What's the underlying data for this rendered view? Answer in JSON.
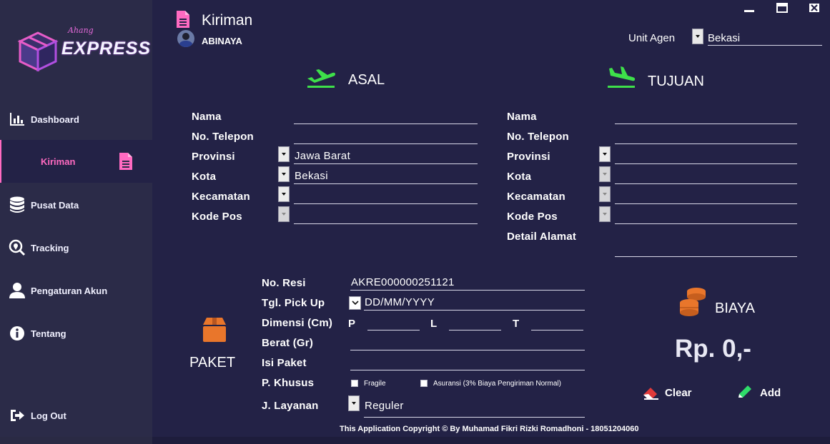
{
  "app": {
    "logo_small": "Ahang",
    "logo_main": "EXPRESS"
  },
  "sidebar": {
    "items": [
      {
        "label": "Dashboard",
        "icon": "chart-icon"
      },
      {
        "label": "Kiriman",
        "icon": "document-icon",
        "active": true
      },
      {
        "label": "Pusat Data",
        "icon": "database-icon"
      },
      {
        "label": "Tracking",
        "icon": "search-location-icon"
      },
      {
        "label": "Pengaturan Akun",
        "icon": "user-icon"
      },
      {
        "label": "Tentang",
        "icon": "info-icon"
      }
    ],
    "logout_label": "Log Out"
  },
  "header": {
    "title": "Kiriman",
    "user": "ABINAYA",
    "window_controls": [
      "minimize",
      "maximize",
      "close"
    ]
  },
  "agent": {
    "label": "Unit Agen",
    "value": "Bekasi"
  },
  "asal": {
    "title": "ASAL",
    "fields": {
      "nama": {
        "label": "Nama",
        "value": ""
      },
      "telepon": {
        "label": "No. Telepon",
        "value": ""
      },
      "provinsi": {
        "label": "Provinsi",
        "value": "Jawa Barat"
      },
      "kota": {
        "label": "Kota",
        "value": "Bekasi"
      },
      "kecamatan": {
        "label": "Kecamatan",
        "value": ""
      },
      "kodepos": {
        "label": "Kode Pos",
        "value": ""
      }
    }
  },
  "tujuan": {
    "title": "TUJUAN",
    "fields": {
      "nama": {
        "label": "Nama",
        "value": ""
      },
      "telepon": {
        "label": "No. Telepon",
        "value": ""
      },
      "provinsi": {
        "label": "Provinsi",
        "value": ""
      },
      "kota": {
        "label": "Kota",
        "value": ""
      },
      "kecamatan": {
        "label": "Kecamatan",
        "value": ""
      },
      "kodepos": {
        "label": "Kode Pos",
        "value": ""
      },
      "detail": {
        "label": "Detail Alamat",
        "value": ""
      }
    }
  },
  "paket": {
    "title": "PAKET",
    "resi": {
      "label": "No. Resi",
      "value": "AKRE000000251121"
    },
    "pickup": {
      "label": "Tgl. Pick Up",
      "value": "DD/MM/YYYY"
    },
    "dimensi": {
      "label": "Dimensi (Cm)",
      "p": "P",
      "l": "L",
      "t": "T"
    },
    "berat": {
      "label": "Berat (Gr)",
      "value": ""
    },
    "isi": {
      "label": "Isi Paket",
      "value": ""
    },
    "khusus": {
      "label": "P. Khusus",
      "fragile": "Fragile",
      "asuransi": "Asuransi (3% Biaya Pengiriman Normal)"
    },
    "layanan": {
      "label": "J. Layanan",
      "value": "Reguler"
    }
  },
  "biaya": {
    "title": "BIAYA",
    "amount": "Rp. 0,-",
    "clear_label": "Clear",
    "add_label": "Add"
  },
  "footer": {
    "copyright": "This Application Copyright © By Muhamad Fikri Rizki Romadhoni - 18051204060"
  },
  "colors": {
    "background": "#232246",
    "sidebar": "#2b2b48",
    "accent_pink": "#ff6ac1",
    "green_icon": "#3ee04a",
    "orange_icon": "#e9762b",
    "red_icon": "#e03a3a"
  }
}
